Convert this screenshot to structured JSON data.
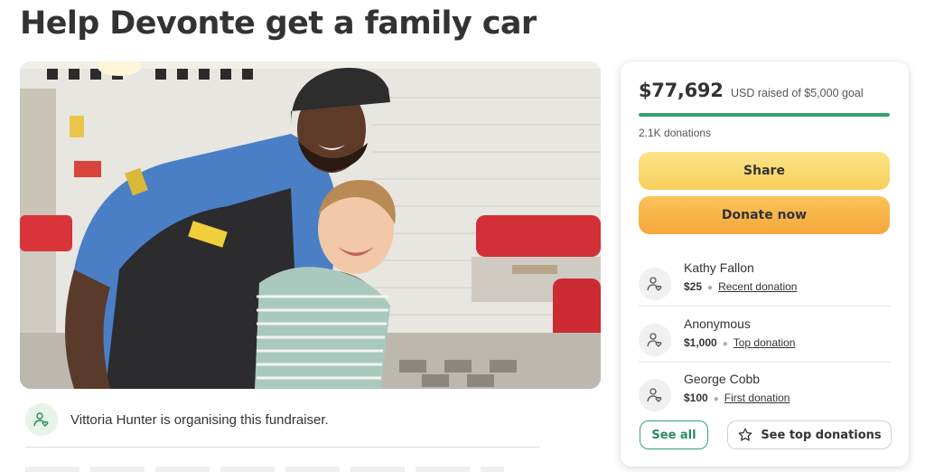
{
  "page": {
    "title": "Help Devonte get a family car"
  },
  "organiser": {
    "text": "Vittoria Hunter is organising this fundraiser."
  },
  "card": {
    "amount": "$77,692",
    "goal_text": "USD raised of $5,000 goal",
    "progress_fraction": 1.0,
    "donation_count": "2.1K donations",
    "share_label": "Share",
    "donate_label": "Donate now",
    "donors": [
      {
        "name": "Kathy Fallon",
        "amount": "$25",
        "tag": "Recent donation"
      },
      {
        "name": "Anonymous",
        "amount": "$1,000",
        "tag": "Top donation"
      },
      {
        "name": "George Cobb",
        "amount": "$100",
        "tag": "First donation"
      }
    ],
    "see_all_label": "See all",
    "see_top_label": "See top donations"
  },
  "colors": {
    "accent_green": "#30a46c",
    "share_yellow": "#f7cf5a",
    "donate_orange": "#f4a73a"
  },
  "icons": {
    "donor_avatar": "heart-hand-icon",
    "organiser_avatar": "person-heart-icon",
    "top_donations": "star-icon"
  }
}
